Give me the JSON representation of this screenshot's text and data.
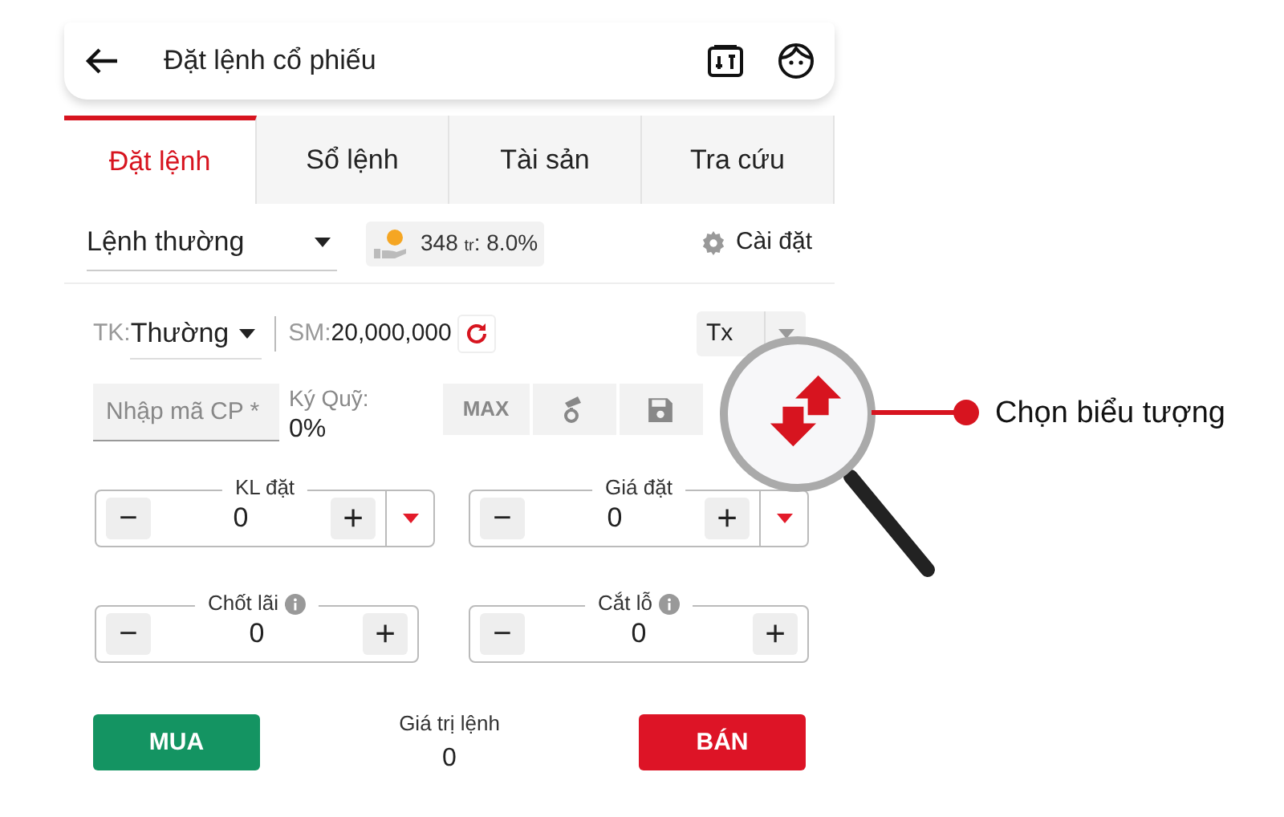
{
  "header": {
    "title": "Đặt lệnh cổ phiếu"
  },
  "tabs": [
    {
      "label": "Đặt lệnh",
      "selected": true
    },
    {
      "label": "Sổ lệnh",
      "selected": false
    },
    {
      "label": "Tài sản",
      "selected": false
    },
    {
      "label": "Tra cứu",
      "selected": false
    }
  ],
  "order_type": {
    "value": "Lệnh thường"
  },
  "credit": {
    "amount": "348",
    "unit": "tr",
    "rate": ": 8.0%"
  },
  "settings": {
    "label": "Cài đặt"
  },
  "account": {
    "label": "TK:",
    "value": "Thường",
    "power_label": "SM:",
    "power": "20,000,000",
    "board": "Tx"
  },
  "symbol": {
    "placeholder": "Nhập mã CP *"
  },
  "margin": {
    "label": "Ký Quỹ:",
    "value": "0%"
  },
  "quick_actions": {
    "max": "MAX"
  },
  "steppers": [
    {
      "label": "KL đặt",
      "value": "0",
      "info": false,
      "dropdown": true
    },
    {
      "label": "Giá đặt",
      "value": "0",
      "info": false,
      "dropdown": true
    },
    {
      "label": "Chốt lãi",
      "value": "0",
      "info": true,
      "dropdown": false
    },
    {
      "label": "Cắt lỗ",
      "value": "0",
      "info": true,
      "dropdown": false
    }
  ],
  "minus": "−",
  "plus": "+",
  "buy": "MUA",
  "sell": "BÁN",
  "order_value": {
    "label": "Giá trị lệnh",
    "value": "0"
  },
  "callout": {
    "text": "Chọn biểu tượng"
  }
}
